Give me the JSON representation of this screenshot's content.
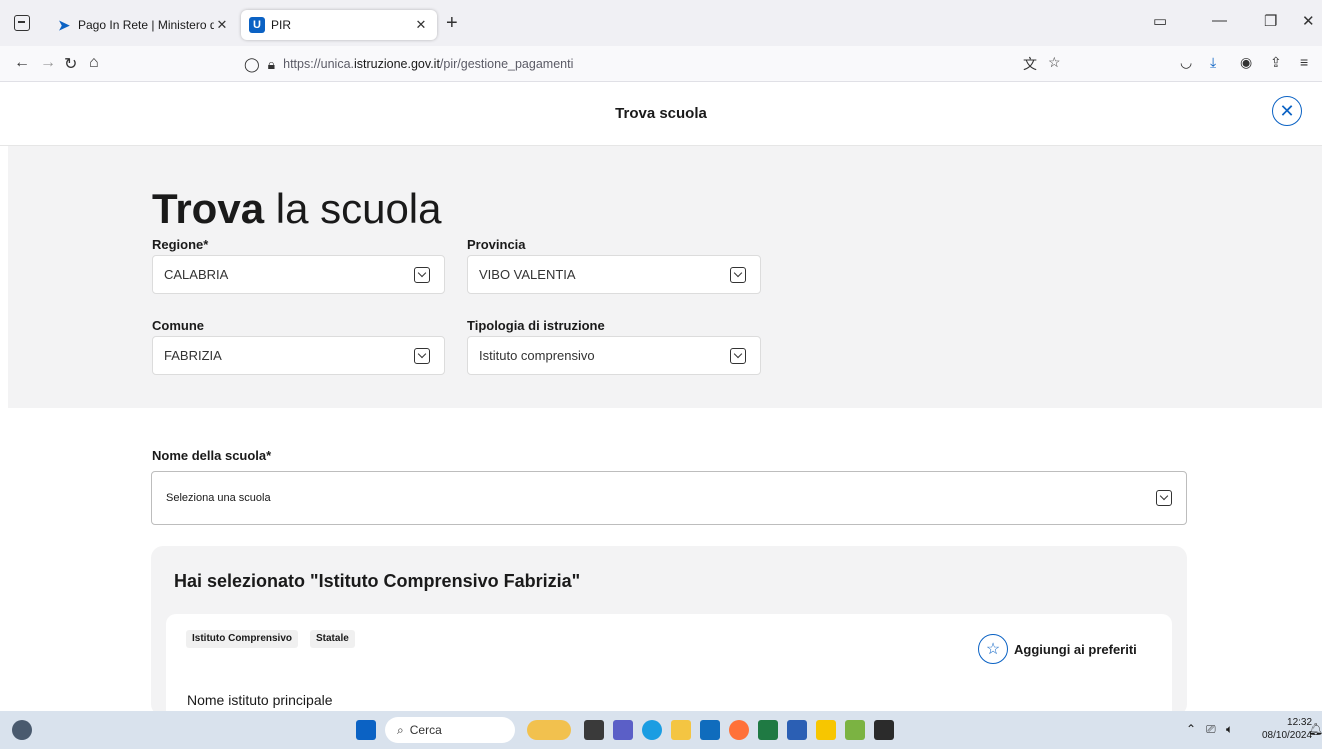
{
  "browser": {
    "tabs": [
      {
        "title": "Pago In Rete | Ministero dell'Istr",
        "favicon": "pago-icon",
        "active": false
      },
      {
        "title": "PIR",
        "favicon": "pir-icon",
        "active": true
      }
    ],
    "url_prefix": "https://unica.",
    "url_domain": "istruzione.gov.it",
    "url_path": "/pir/gestione_pagamenti"
  },
  "header": {
    "title": "Trova scuola"
  },
  "search": {
    "heading_bold": "Trova",
    "heading_rest": "la scuola",
    "regione_label": "Regione*",
    "regione_value": "CALABRIA",
    "provincia_label": "Provincia",
    "provincia_value": "VIBO VALENTIA",
    "comune_label": "Comune",
    "comune_value": "FABRIZIA",
    "tipologia_label": "Tipologia di istruzione",
    "tipologia_value": "Istituto comprensivo"
  },
  "school": {
    "label": "Nome della scuola*",
    "placeholder": "Seleziona una scuola"
  },
  "result": {
    "title": "Hai selezionato \"Istituto Comprensivo Fabrizia\"",
    "tags": [
      "Istituto Comprensivo",
      "Statale"
    ],
    "favorite_label": "Aggiungi ai preferiti",
    "institute_label": "Nome istituto principale"
  },
  "taskbar": {
    "search_placeholder": "Cerca",
    "time": "12:32",
    "date": "08/10/2024"
  },
  "colors": {
    "accent": "#0b62c4",
    "band": "#f3f3f4"
  }
}
